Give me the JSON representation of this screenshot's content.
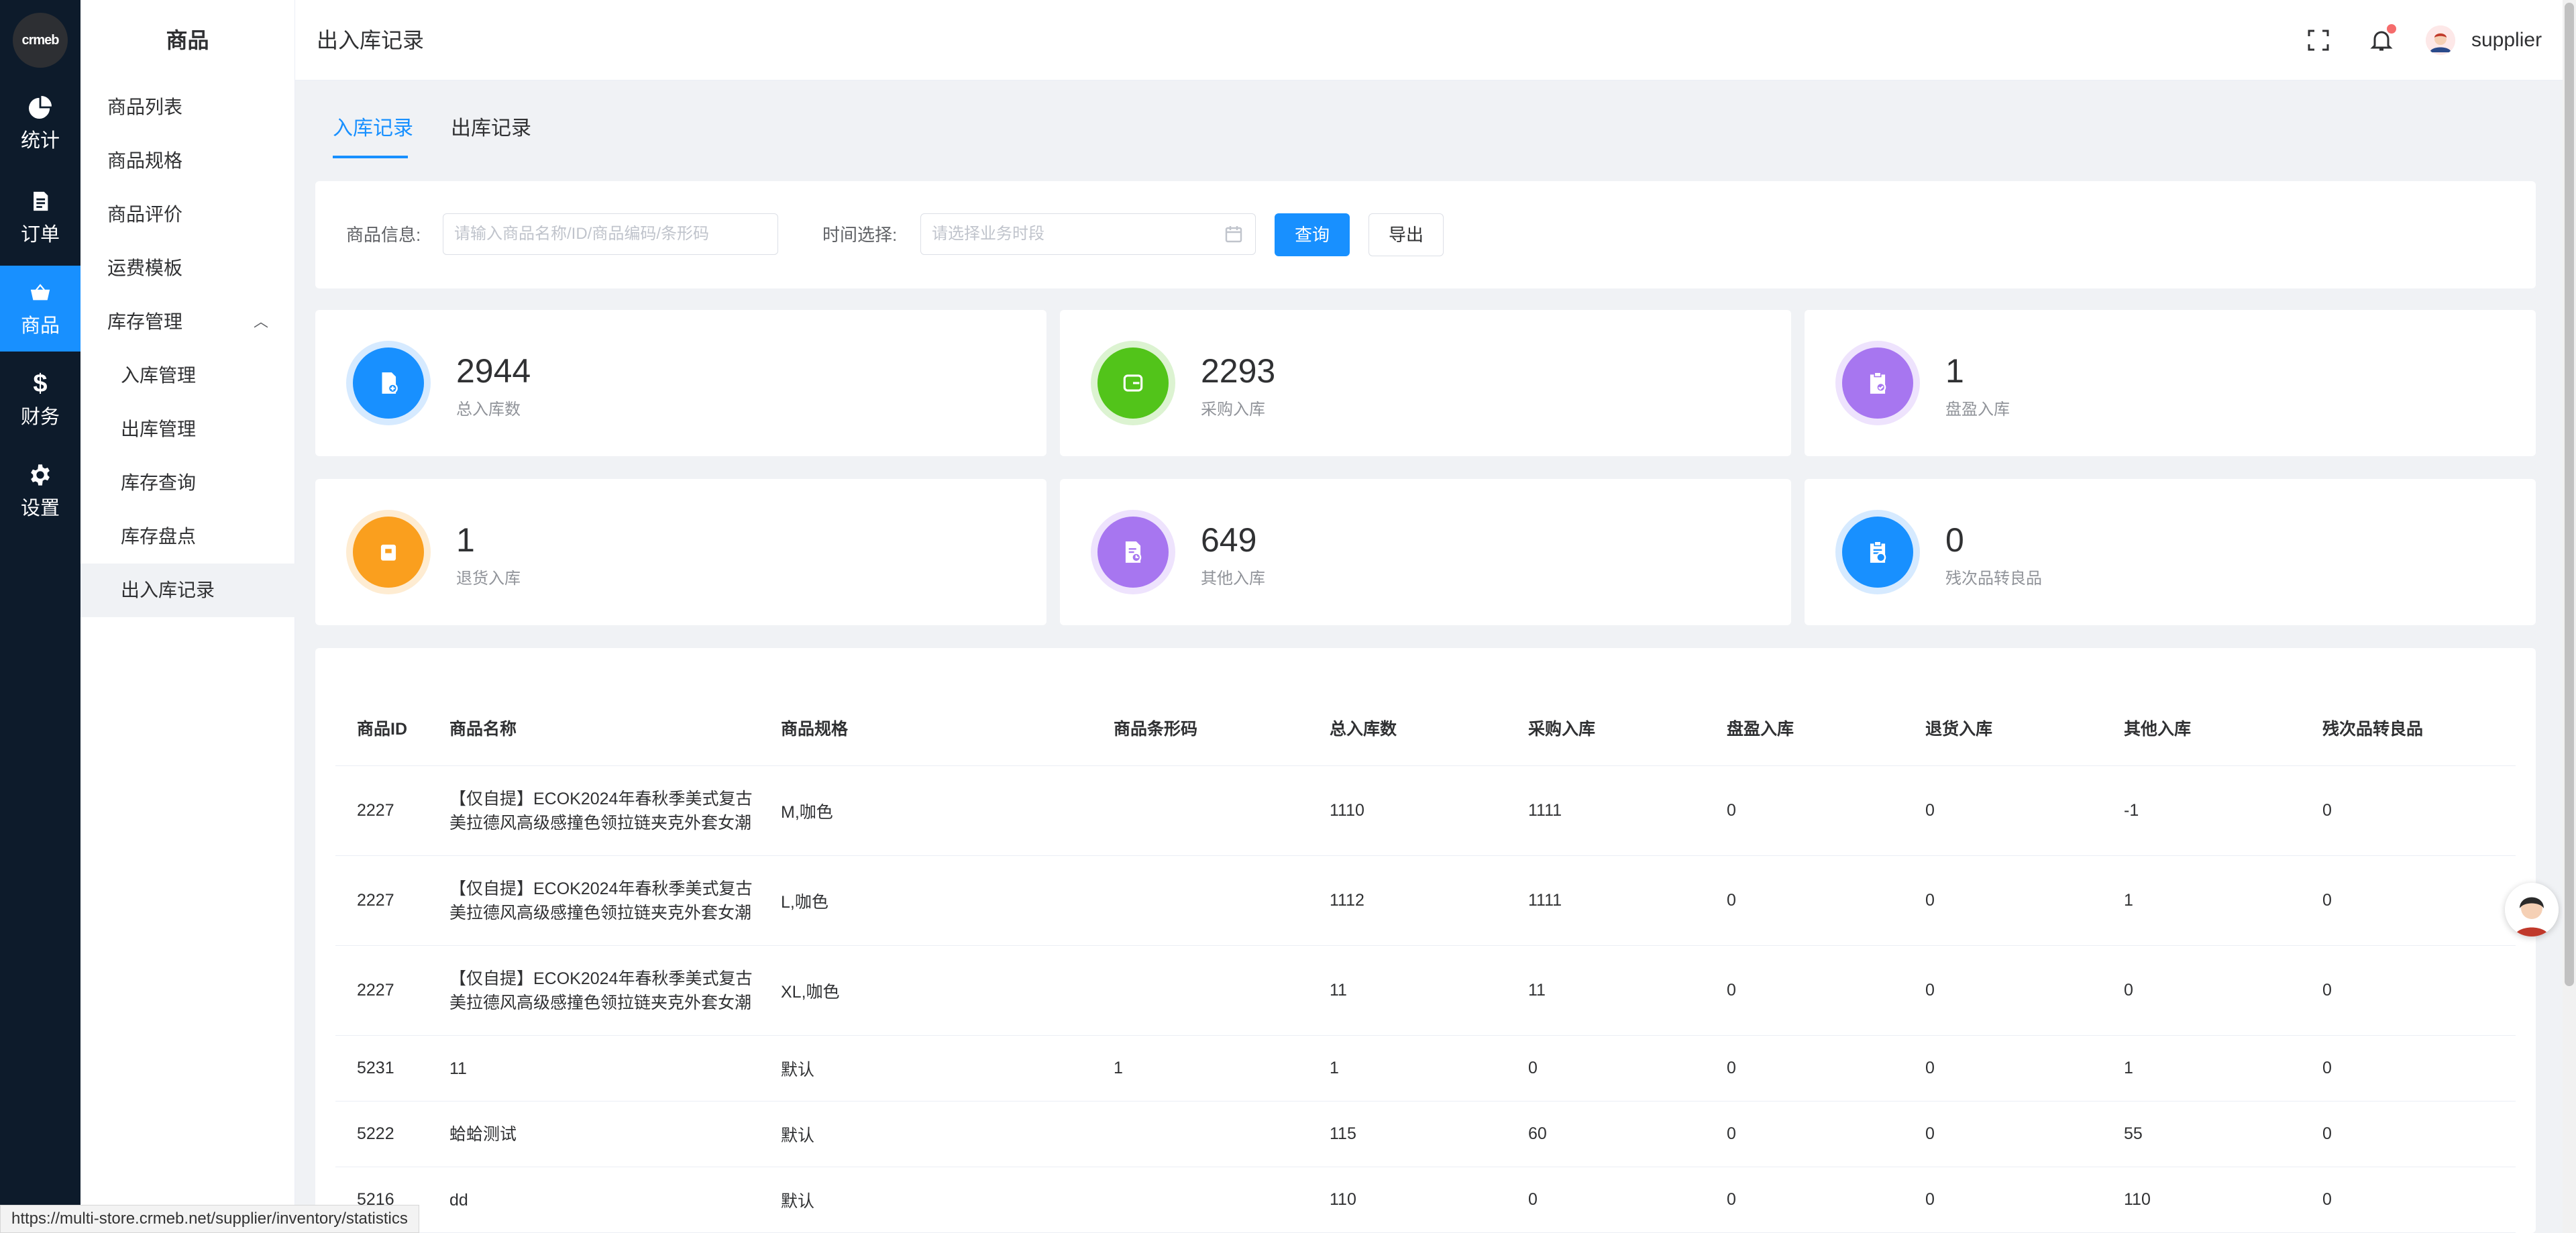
{
  "rail": {
    "logo_text": "crmeb",
    "items": [
      {
        "label": "统计",
        "icon": "pie-chart-icon"
      },
      {
        "label": "订单",
        "icon": "document-icon"
      },
      {
        "label": "商品",
        "icon": "shopping-basket-icon",
        "active": true
      },
      {
        "label": "财务",
        "icon": "dollar-icon"
      },
      {
        "label": "设置",
        "icon": "gear-icon"
      }
    ]
  },
  "submenu": {
    "title": "商品",
    "items": [
      {
        "label": "商品列表"
      },
      {
        "label": "商品规格"
      },
      {
        "label": "商品评价"
      },
      {
        "label": "运费模板"
      },
      {
        "label": "库存管理",
        "expanded": true
      },
      {
        "label": "入库管理"
      },
      {
        "label": "出库管理"
      },
      {
        "label": "库存查询"
      },
      {
        "label": "库存盘点"
      },
      {
        "label": "出入库记录",
        "active": true
      }
    ]
  },
  "header": {
    "title": "出入库记录",
    "username": "supplier",
    "fullscreen_icon": "fullscreen-icon",
    "bell_icon": "bell-icon",
    "has_notification": true
  },
  "tabs": [
    {
      "label": "入库记录",
      "active": true
    },
    {
      "label": "出库记录",
      "active": false
    }
  ],
  "filter": {
    "product_label": "商品信息:",
    "product_placeholder": "请输入商品名称/ID/商品编码/条形码",
    "time_label": "时间选择:",
    "time_placeholder": "请选择业务时段",
    "query_button": "查询",
    "export_button": "导出"
  },
  "stats": [
    {
      "value": "2944",
      "label": "总入库数",
      "color": "#1890ff",
      "icon": "document-add-icon"
    },
    {
      "value": "2293",
      "label": "采购入库",
      "color": "#52c41a",
      "icon": "wallet-icon"
    },
    {
      "value": "1",
      "label": "盘盈入库",
      "color": "#a776f0",
      "icon": "clipboard-check-icon"
    },
    {
      "value": "1",
      "label": "退货入库",
      "color": "#fa9f1e",
      "icon": "return-box-icon"
    },
    {
      "value": "649",
      "label": "其他入库",
      "color": "#a776f0",
      "icon": "document-time-icon"
    },
    {
      "value": "0",
      "label": "残次品转良品",
      "color": "#1890ff",
      "icon": "clipboard-refresh-icon"
    }
  ],
  "table": {
    "headers": [
      "商品ID",
      "商品名称",
      "商品规格",
      "商品条形码",
      "总入库数",
      "采购入库",
      "盘盈入库",
      "退货入库",
      "其他入库",
      "残次品转良品"
    ],
    "rows": [
      [
        "2227",
        "【仅自提】ECOK2024年春秋季美式复古美拉德风高级感撞色领拉链夹克外套女潮",
        "M,咖色",
        "",
        "1110",
        "1111",
        "0",
        "0",
        "-1",
        "0"
      ],
      [
        "2227",
        "【仅自提】ECOK2024年春秋季美式复古美拉德风高级感撞色领拉链夹克外套女潮",
        "L,咖色",
        "",
        "1112",
        "1111",
        "0",
        "0",
        "1",
        "0"
      ],
      [
        "2227",
        "【仅自提】ECOK2024年春秋季美式复古美拉德风高级感撞色领拉链夹克外套女潮",
        "XL,咖色",
        "",
        "11",
        "11",
        "0",
        "0",
        "0",
        "0"
      ],
      [
        "5231",
        "11",
        "默认",
        "1",
        "1",
        "0",
        "0",
        "0",
        "1",
        "0"
      ],
      [
        "5222",
        "蛤蛤测试",
        "默认",
        "",
        "115",
        "60",
        "0",
        "0",
        "55",
        "0"
      ],
      [
        "5216",
        "dd",
        "默认",
        "",
        "110",
        "0",
        "0",
        "0",
        "110",
        "0"
      ]
    ]
  },
  "statusbar": {
    "url": "https://multi-store.crmeb.net/supplier/inventory/statistics"
  }
}
